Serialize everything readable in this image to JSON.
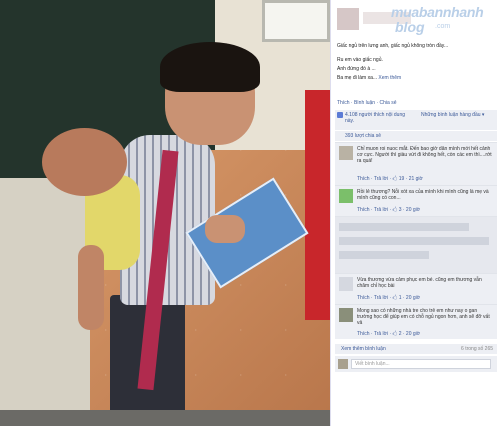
{
  "post": {
    "caption_line1": "Giấc ngủ trên lưng anh, giấc ngủ không tròn đầy...",
    "caption_line2": "Ru em vào giấc ngủ.",
    "caption_line3": "Anh đứng đó à ...",
    "caption_line4": "Ba mẹ đi làm xa...",
    "see_more": "Xem thêm",
    "actions": "Thích · Bình luận · Chia sẻ"
  },
  "watermark": {
    "main": "muabannhanh",
    "sub": "blog",
    "com": ".com"
  },
  "likes": {
    "text": "4.108 người thích nội dung này.",
    "top_comments": "Những bình luận hàng đầu ▾"
  },
  "shares": "393 lượt chia sẻ",
  "comments": [
    {
      "text": "Chỉ muon roi nuoc mắt. Đến bao giờ dân mình mới hết cảnh cơ cực. Người thì giàu vứt đi không hết, còn các em thì....rớt ra quá!",
      "meta": "Thích · Trả lời · 🖒 19 · 21 giờ"
    },
    {
      "text": "Rồi lẻ thương? Nỗi xót xa của mình khi mình cũng là mẹ và mình cũng có con...",
      "meta": "Thích · Trả lời · 🖒 3 · 20 giờ"
    },
    {
      "text": "Vừa thương vừa cảm phục em bé. cũng em thương vẫn chăm chỉ học bài",
      "meta": "Thích · Trả lời · 🖒 1 · 20 giờ"
    },
    {
      "text": "Mong sao có những nhà tre cho trẻ em như nay o gan trường học để giúp em có chỗ ngủ ngon hơn, anh sẽ đỡ vất vả",
      "meta": "Thích · Trả lời · 🖒 2 · 20 giờ"
    }
  ],
  "more_comments": "Xem thêm bình luận",
  "comment_count": "6 trong số 265",
  "reply_placeholder": "Viết bình luận..."
}
